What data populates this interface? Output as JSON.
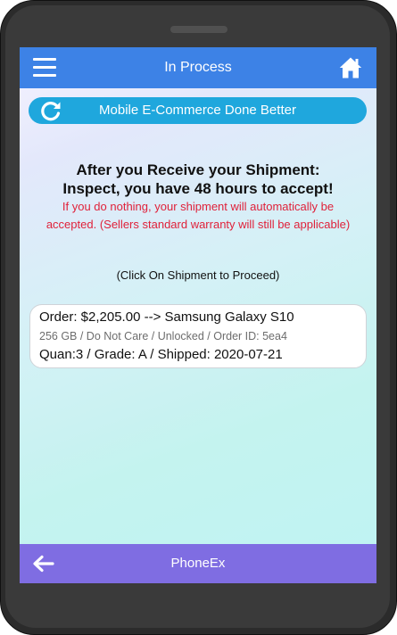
{
  "header": {
    "title": "In Process",
    "menu_icon": "hamburger-menu-icon",
    "home_icon": "home-icon",
    "color": "#3d82e6"
  },
  "banner": {
    "label": "Mobile E-Commerce Done Better",
    "icon": "refresh-icon",
    "color": "#1fa7dd"
  },
  "notice": {
    "headline_1": "After you Receive your Shipment:",
    "headline_2": "Inspect, you have 48 hours to accept!",
    "warning": "If you do nothing, your shipment will automatically be accepted. (Sellers standard warranty will still be applicable)",
    "warning_color": "#e0213a",
    "hint": "(Click On Shipment to Proceed)"
  },
  "orders": [
    {
      "line1": "Order: $2,205.00 --> Samsung Galaxy S10",
      "line2": "256 GB / Do Not Care / Unlocked / Order ID: 5ea4",
      "line3": "Quan:3 / Grade: A / Shipped: 2020-07-21"
    }
  ],
  "footer": {
    "title": "PhoneEx",
    "back_icon": "arrow-left-icon",
    "color": "#7f6de2"
  }
}
